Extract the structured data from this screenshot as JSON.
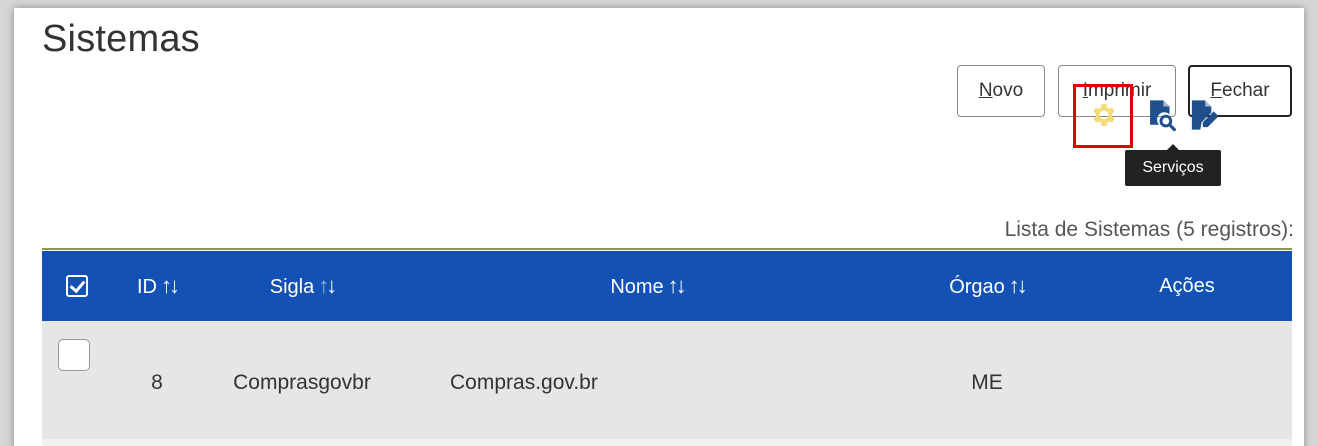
{
  "page": {
    "title": "Sistemas"
  },
  "toolbar": {
    "novo": {
      "key": "N",
      "rest": "ovo"
    },
    "imprimir": {
      "key": "I",
      "rest": "mprimir"
    },
    "fechar": {
      "key": "F",
      "rest": "echar"
    }
  },
  "list": {
    "caption": "Lista de Sistemas (5 registros):",
    "columns": {
      "id": "ID",
      "sigla": "Sigla",
      "nome": "Nome",
      "orgao": "Órgao",
      "acoes": "Ações"
    },
    "sort_glyphs": {
      "up": "↑",
      "down": "↓"
    },
    "rows": [
      {
        "id": "8",
        "sigla": "Comprasgovbr",
        "nome": "Compras.gov.br",
        "orgao": "ME"
      }
    ]
  },
  "actions": {
    "tooltip": "Serviços",
    "icons": [
      "gear-icon",
      "search-document-icon",
      "edit-document-icon"
    ]
  },
  "colors": {
    "header_bg": "#1351b4",
    "row_bg": "#e6e6e6",
    "highlight": "#e10000",
    "gear": "#f5dc7a",
    "action_icon": "#1e4f8a"
  }
}
